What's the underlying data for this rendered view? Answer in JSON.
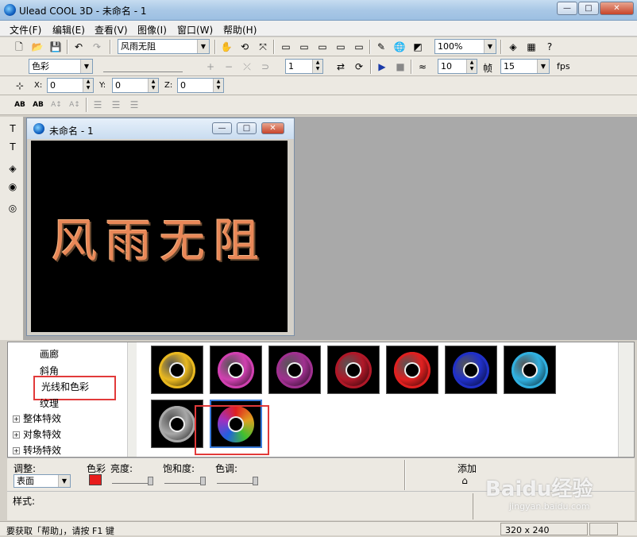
{
  "app": {
    "title": "Ulead COOL 3D - 未命名 - 1"
  },
  "window_buttons": {
    "minimize": "—",
    "maximize": "□",
    "close": "✕"
  },
  "menu": [
    "文件(F)",
    "编辑(E)",
    "查看(V)",
    "图像(I)",
    "窗口(W)",
    "帮助(H)"
  ],
  "toolbar1": {
    "text_object": "风雨无阻",
    "zoom": "100%"
  },
  "toolbar2": {
    "attribute": "色彩",
    "frame_value": "1",
    "fps_value": "10",
    "frame_label": "帧",
    "fps_count": "15",
    "fps_label": "fps"
  },
  "position": {
    "x_label": "X:",
    "x": "0",
    "y_label": "Y:",
    "y": "0",
    "z_label": "Z:",
    "z": "0"
  },
  "document": {
    "title": "未命名 - 1",
    "canvas_text": "风雨无阻"
  },
  "tree": {
    "items": [
      "画廊",
      "斜角",
      "光线和色彩",
      "纹理"
    ],
    "groups": [
      "整体特效",
      "对象特效",
      "转场特效"
    ]
  },
  "thumbnails": [
    {
      "name": "gold",
      "color": "#e8b820"
    },
    {
      "name": "pink",
      "color": "#d040b0"
    },
    {
      "name": "purple",
      "color": "#a03090"
    },
    {
      "name": "dark-red",
      "color": "#b01828"
    },
    {
      "name": "red",
      "color": "#e02020"
    },
    {
      "name": "blue",
      "color": "#2030c8"
    },
    {
      "name": "cyan",
      "color": "#30b0e0"
    },
    {
      "name": "silver",
      "color": "#a8a8a8"
    },
    {
      "name": "rainbow",
      "color": "#40a030"
    }
  ],
  "properties": {
    "adjust_label": "调整:",
    "adjust_value": "表面",
    "color_label": "色彩",
    "color_swatch": "#e81c1c",
    "brightness_label": "亮度:",
    "saturation_label": "饱和度:",
    "hue_label": "色调:",
    "add_label": "添加"
  },
  "style_label": "样式:",
  "status": {
    "hint": "要获取「帮助」，请按 F1 键",
    "size": "320 x 240"
  },
  "watermark": {
    "brand": "Baidu经验",
    "url": "jingyan.baidu.com"
  }
}
